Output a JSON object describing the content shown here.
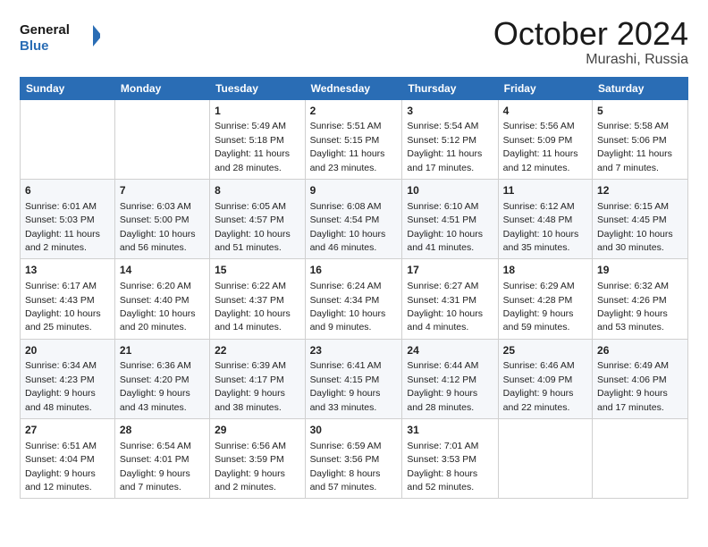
{
  "header": {
    "logo_general": "General",
    "logo_blue": "Blue",
    "month_title": "October 2024",
    "location": "Murashi, Russia"
  },
  "days_of_week": [
    "Sunday",
    "Monday",
    "Tuesday",
    "Wednesday",
    "Thursday",
    "Friday",
    "Saturday"
  ],
  "weeks": [
    [
      {
        "day": "",
        "info": ""
      },
      {
        "day": "",
        "info": ""
      },
      {
        "day": "1",
        "info": "Sunrise: 5:49 AM\nSunset: 5:18 PM\nDaylight: 11 hours and 28 minutes."
      },
      {
        "day": "2",
        "info": "Sunrise: 5:51 AM\nSunset: 5:15 PM\nDaylight: 11 hours and 23 minutes."
      },
      {
        "day": "3",
        "info": "Sunrise: 5:54 AM\nSunset: 5:12 PM\nDaylight: 11 hours and 17 minutes."
      },
      {
        "day": "4",
        "info": "Sunrise: 5:56 AM\nSunset: 5:09 PM\nDaylight: 11 hours and 12 minutes."
      },
      {
        "day": "5",
        "info": "Sunrise: 5:58 AM\nSunset: 5:06 PM\nDaylight: 11 hours and 7 minutes."
      }
    ],
    [
      {
        "day": "6",
        "info": "Sunrise: 6:01 AM\nSunset: 5:03 PM\nDaylight: 11 hours and 2 minutes."
      },
      {
        "day": "7",
        "info": "Sunrise: 6:03 AM\nSunset: 5:00 PM\nDaylight: 10 hours and 56 minutes."
      },
      {
        "day": "8",
        "info": "Sunrise: 6:05 AM\nSunset: 4:57 PM\nDaylight: 10 hours and 51 minutes."
      },
      {
        "day": "9",
        "info": "Sunrise: 6:08 AM\nSunset: 4:54 PM\nDaylight: 10 hours and 46 minutes."
      },
      {
        "day": "10",
        "info": "Sunrise: 6:10 AM\nSunset: 4:51 PM\nDaylight: 10 hours and 41 minutes."
      },
      {
        "day": "11",
        "info": "Sunrise: 6:12 AM\nSunset: 4:48 PM\nDaylight: 10 hours and 35 minutes."
      },
      {
        "day": "12",
        "info": "Sunrise: 6:15 AM\nSunset: 4:45 PM\nDaylight: 10 hours and 30 minutes."
      }
    ],
    [
      {
        "day": "13",
        "info": "Sunrise: 6:17 AM\nSunset: 4:43 PM\nDaylight: 10 hours and 25 minutes."
      },
      {
        "day": "14",
        "info": "Sunrise: 6:20 AM\nSunset: 4:40 PM\nDaylight: 10 hours and 20 minutes."
      },
      {
        "day": "15",
        "info": "Sunrise: 6:22 AM\nSunset: 4:37 PM\nDaylight: 10 hours and 14 minutes."
      },
      {
        "day": "16",
        "info": "Sunrise: 6:24 AM\nSunset: 4:34 PM\nDaylight: 10 hours and 9 minutes."
      },
      {
        "day": "17",
        "info": "Sunrise: 6:27 AM\nSunset: 4:31 PM\nDaylight: 10 hours and 4 minutes."
      },
      {
        "day": "18",
        "info": "Sunrise: 6:29 AM\nSunset: 4:28 PM\nDaylight: 9 hours and 59 minutes."
      },
      {
        "day": "19",
        "info": "Sunrise: 6:32 AM\nSunset: 4:26 PM\nDaylight: 9 hours and 53 minutes."
      }
    ],
    [
      {
        "day": "20",
        "info": "Sunrise: 6:34 AM\nSunset: 4:23 PM\nDaylight: 9 hours and 48 minutes."
      },
      {
        "day": "21",
        "info": "Sunrise: 6:36 AM\nSunset: 4:20 PM\nDaylight: 9 hours and 43 minutes."
      },
      {
        "day": "22",
        "info": "Sunrise: 6:39 AM\nSunset: 4:17 PM\nDaylight: 9 hours and 38 minutes."
      },
      {
        "day": "23",
        "info": "Sunrise: 6:41 AM\nSunset: 4:15 PM\nDaylight: 9 hours and 33 minutes."
      },
      {
        "day": "24",
        "info": "Sunrise: 6:44 AM\nSunset: 4:12 PM\nDaylight: 9 hours and 28 minutes."
      },
      {
        "day": "25",
        "info": "Sunrise: 6:46 AM\nSunset: 4:09 PM\nDaylight: 9 hours and 22 minutes."
      },
      {
        "day": "26",
        "info": "Sunrise: 6:49 AM\nSunset: 4:06 PM\nDaylight: 9 hours and 17 minutes."
      }
    ],
    [
      {
        "day": "27",
        "info": "Sunrise: 6:51 AM\nSunset: 4:04 PM\nDaylight: 9 hours and 12 minutes."
      },
      {
        "day": "28",
        "info": "Sunrise: 6:54 AM\nSunset: 4:01 PM\nDaylight: 9 hours and 7 minutes."
      },
      {
        "day": "29",
        "info": "Sunrise: 6:56 AM\nSunset: 3:59 PM\nDaylight: 9 hours and 2 minutes."
      },
      {
        "day": "30",
        "info": "Sunrise: 6:59 AM\nSunset: 3:56 PM\nDaylight: 8 hours and 57 minutes."
      },
      {
        "day": "31",
        "info": "Sunrise: 7:01 AM\nSunset: 3:53 PM\nDaylight: 8 hours and 52 minutes."
      },
      {
        "day": "",
        "info": ""
      },
      {
        "day": "",
        "info": ""
      }
    ]
  ]
}
